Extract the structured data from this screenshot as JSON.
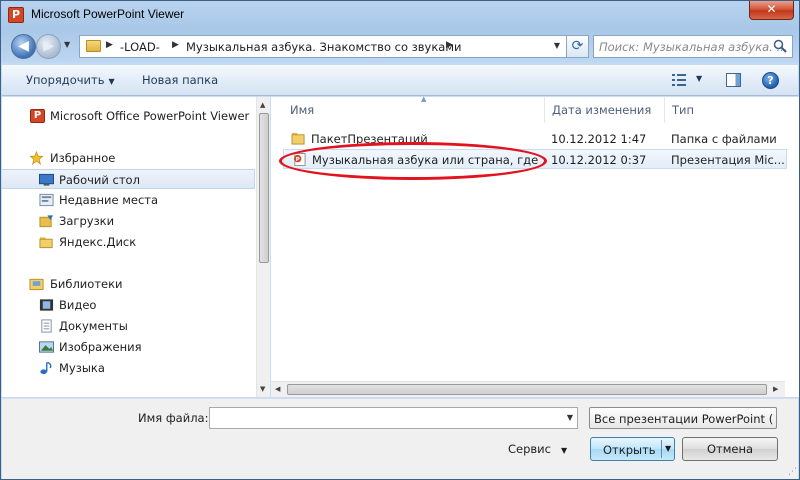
{
  "window": {
    "title": "Microsoft PowerPoint Viewer",
    "close_label": "✕"
  },
  "address": {
    "crumbs": [
      "-LOAD-",
      "Музыкальная азбука. Знакомство со звуками"
    ],
    "search_placeholder": "Поиск: Музыкальная азбука. ..."
  },
  "toolbar": {
    "organize_label": "Упорядочить",
    "new_folder_label": "Новая папка"
  },
  "nav": {
    "items": [
      {
        "label": "Microsoft Office PowerPoint Viewer",
        "icon": "powerpoint-icon"
      },
      {
        "label": "Избранное",
        "icon": "star-icon"
      },
      {
        "label": "Рабочий стол",
        "icon": "desktop-icon"
      },
      {
        "label": "Недавние места",
        "icon": "recent-places-icon"
      },
      {
        "label": "Загрузки",
        "icon": "downloads-icon"
      },
      {
        "label": "Яндекс.Диск",
        "icon": "folder-icon"
      },
      {
        "label": "Библиотеки",
        "icon": "libraries-icon"
      },
      {
        "label": "Видео",
        "icon": "video-icon"
      },
      {
        "label": "Документы",
        "icon": "documents-icon"
      },
      {
        "label": "Изображения",
        "icon": "pictures-icon"
      },
      {
        "label": "Музыка",
        "icon": "music-icon"
      }
    ]
  },
  "files": {
    "columns": [
      "Имя",
      "Дата изменения",
      "Тип"
    ],
    "rows": [
      {
        "name": "ПакетПрезентаций",
        "date": "10.12.2012 1:47",
        "type": "Папка с файлами",
        "icon": "folder-icon"
      },
      {
        "name": "Музыкальная азбука или страна, где ж...",
        "date": "10.12.2012 0:37",
        "type": "Презентация Mic...",
        "icon": "presentation-file-icon"
      }
    ]
  },
  "bottom": {
    "filename_label": "Имя файла:",
    "filename_value": "",
    "filetype_value": "Все презентации PowerPoint (",
    "tools_label": "Сервис",
    "open_label": "Открыть",
    "cancel_label": "Отмена"
  },
  "colors": {
    "highlight_oval": "#e2131f",
    "selection": "#e3edf8"
  }
}
